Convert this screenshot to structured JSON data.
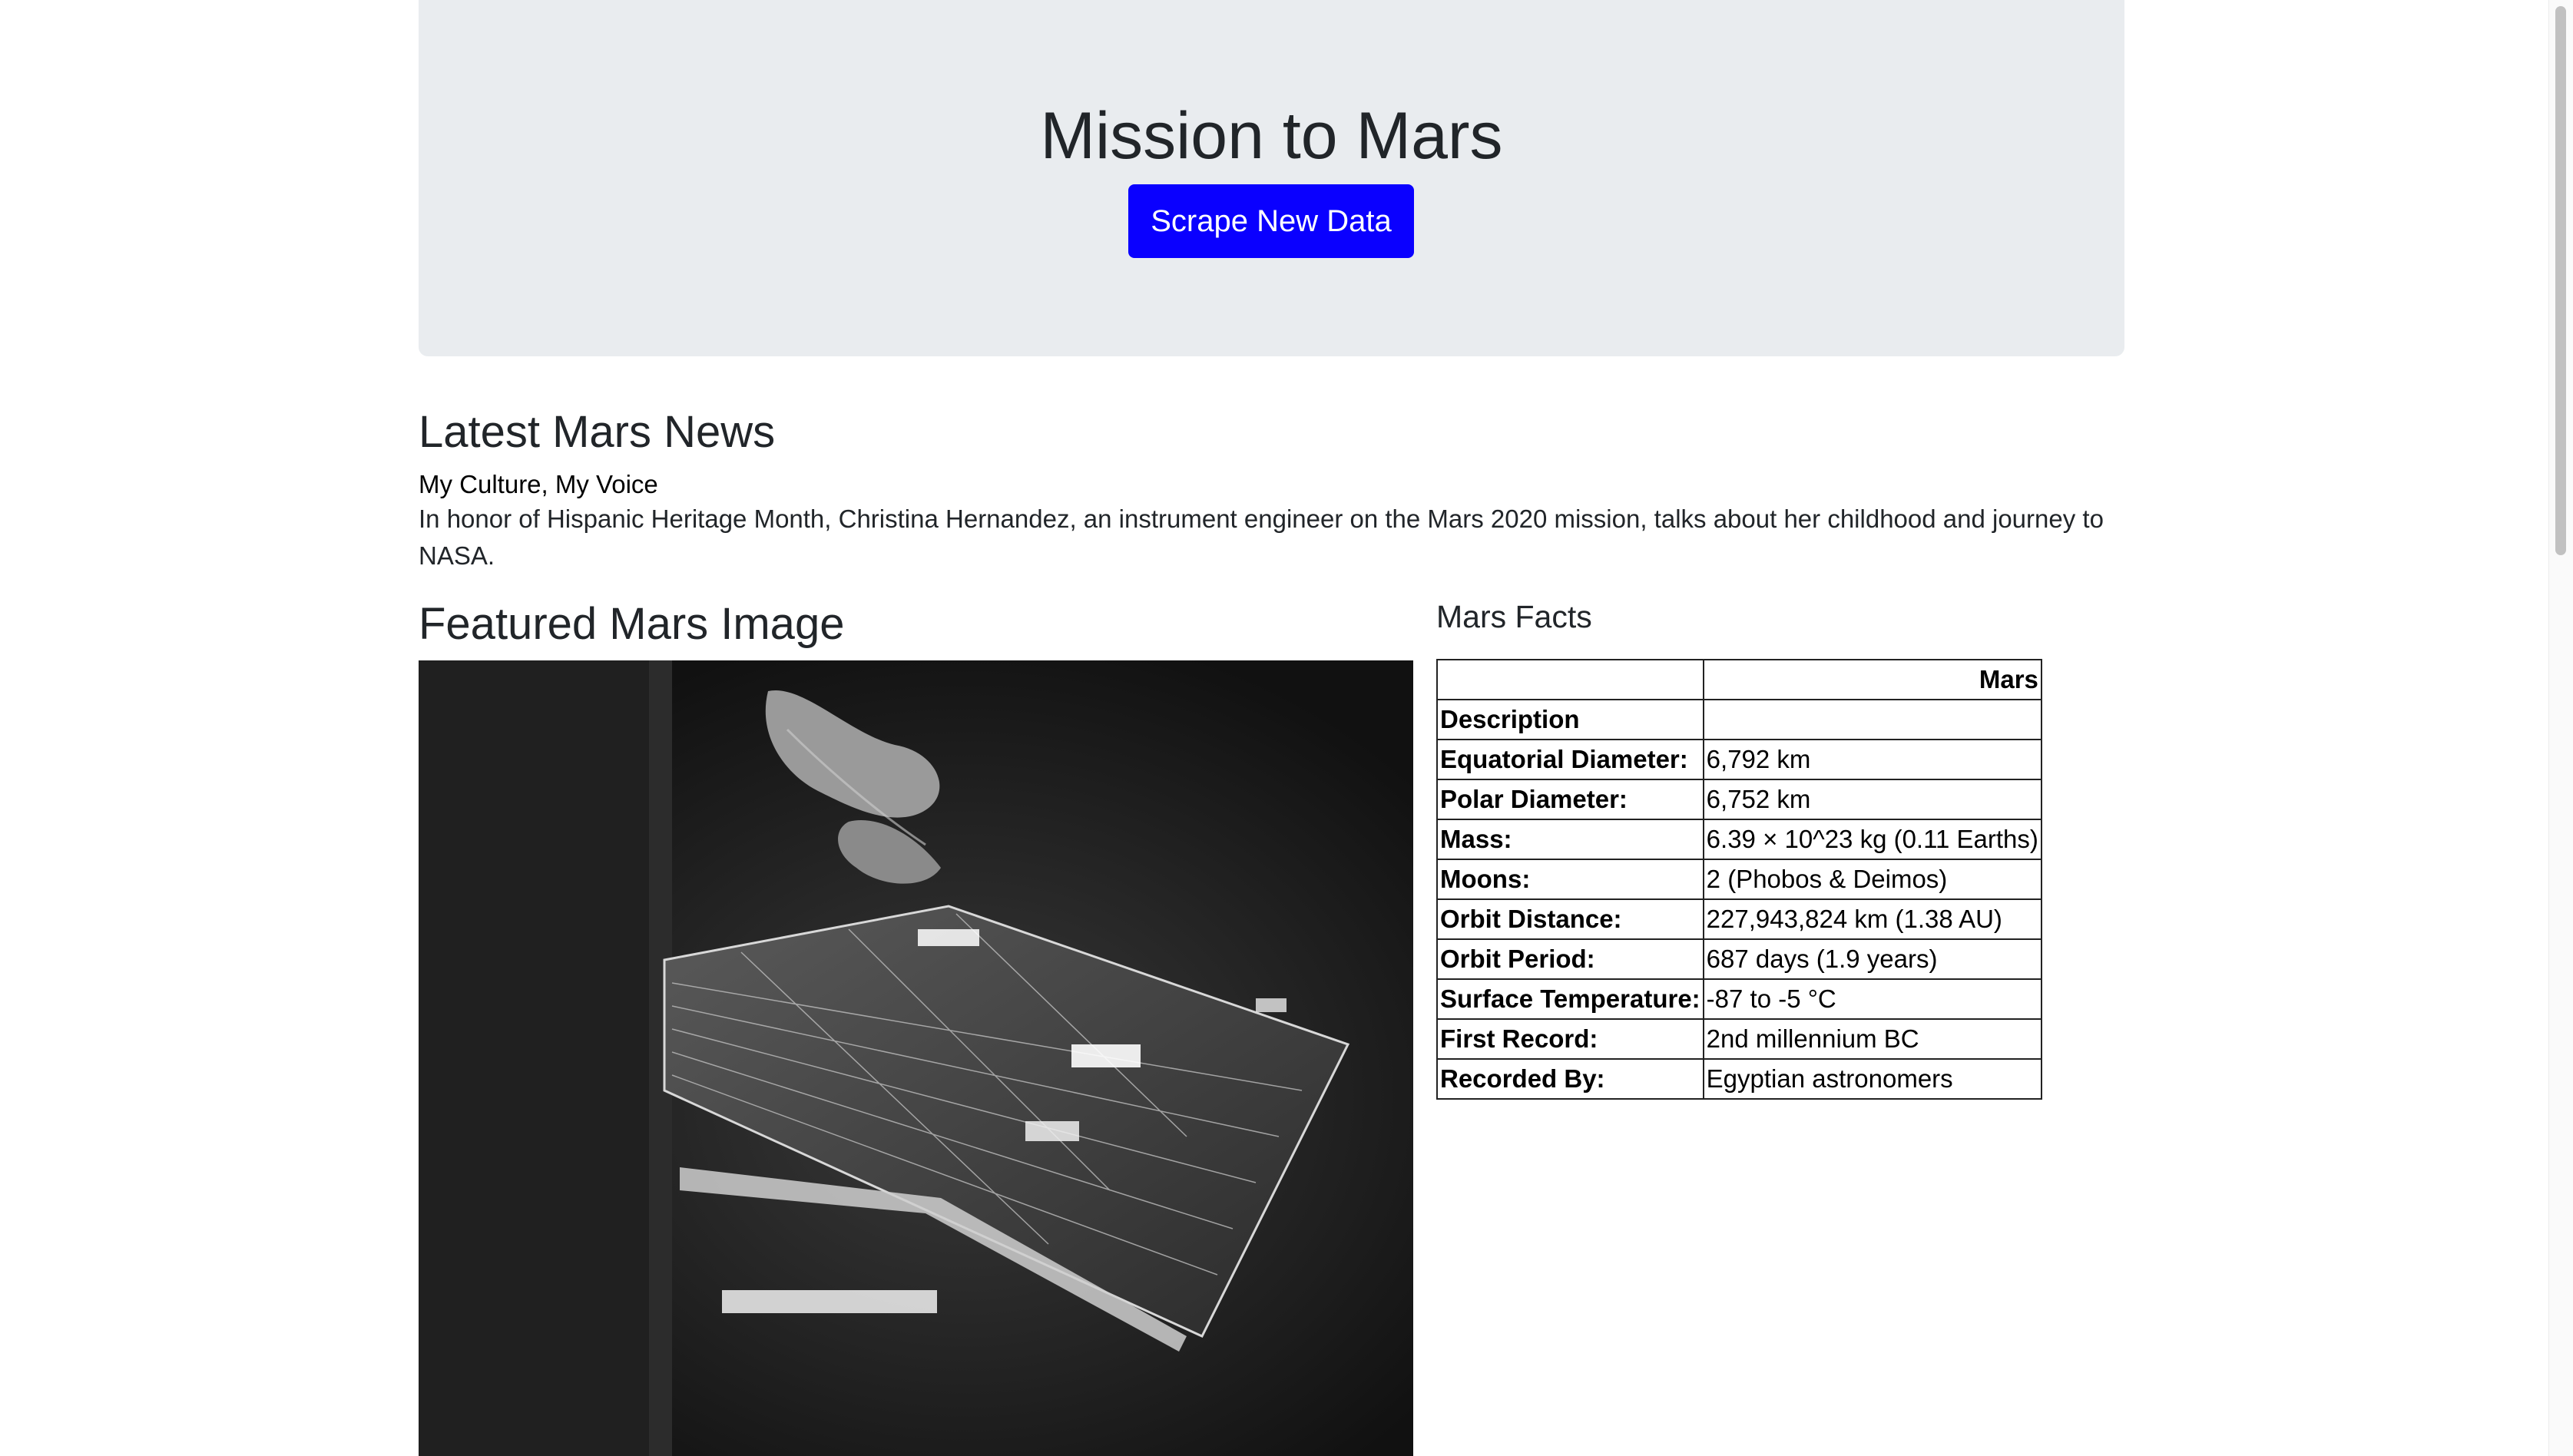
{
  "header": {
    "title": "Mission to Mars",
    "scrape_button_label": "Scrape New Data",
    "button_color": "#0a00ff",
    "background_color": "#e9ecef"
  },
  "news": {
    "heading": "Latest Mars News",
    "title": "My Culture, My Voice",
    "paragraph": "In honor of Hispanic Heritage Month, Christina Hernandez, an instrument engineer on the Mars 2020 mission, talks about her childhood and journey to NASA."
  },
  "featured_image": {
    "heading": "Featured Mars Image",
    "subject": "grayscale photo of spacecraft solar panel with comet in background"
  },
  "facts": {
    "heading": "Mars Facts",
    "column_header": "Mars",
    "rows": [
      {
        "label": "Description",
        "value": ""
      },
      {
        "label": "Equatorial Diameter:",
        "value": "6,792 km"
      },
      {
        "label": "Polar Diameter:",
        "value": "6,752 km"
      },
      {
        "label": "Mass:",
        "value": "6.39 × 10^23 kg (0.11 Earths)"
      },
      {
        "label": "Moons:",
        "value": "2 (Phobos & Deimos)"
      },
      {
        "label": "Orbit Distance:",
        "value": "227,943,824 km (1.38 AU)"
      },
      {
        "label": "Orbit Period:",
        "value": "687 days (1.9 years)"
      },
      {
        "label": "Surface Temperature:",
        "value": "-87 to -5 °C"
      },
      {
        "label": "First Record:",
        "value": "2nd millennium BC"
      },
      {
        "label": "Recorded By:",
        "value": "Egyptian astronomers"
      }
    ]
  }
}
